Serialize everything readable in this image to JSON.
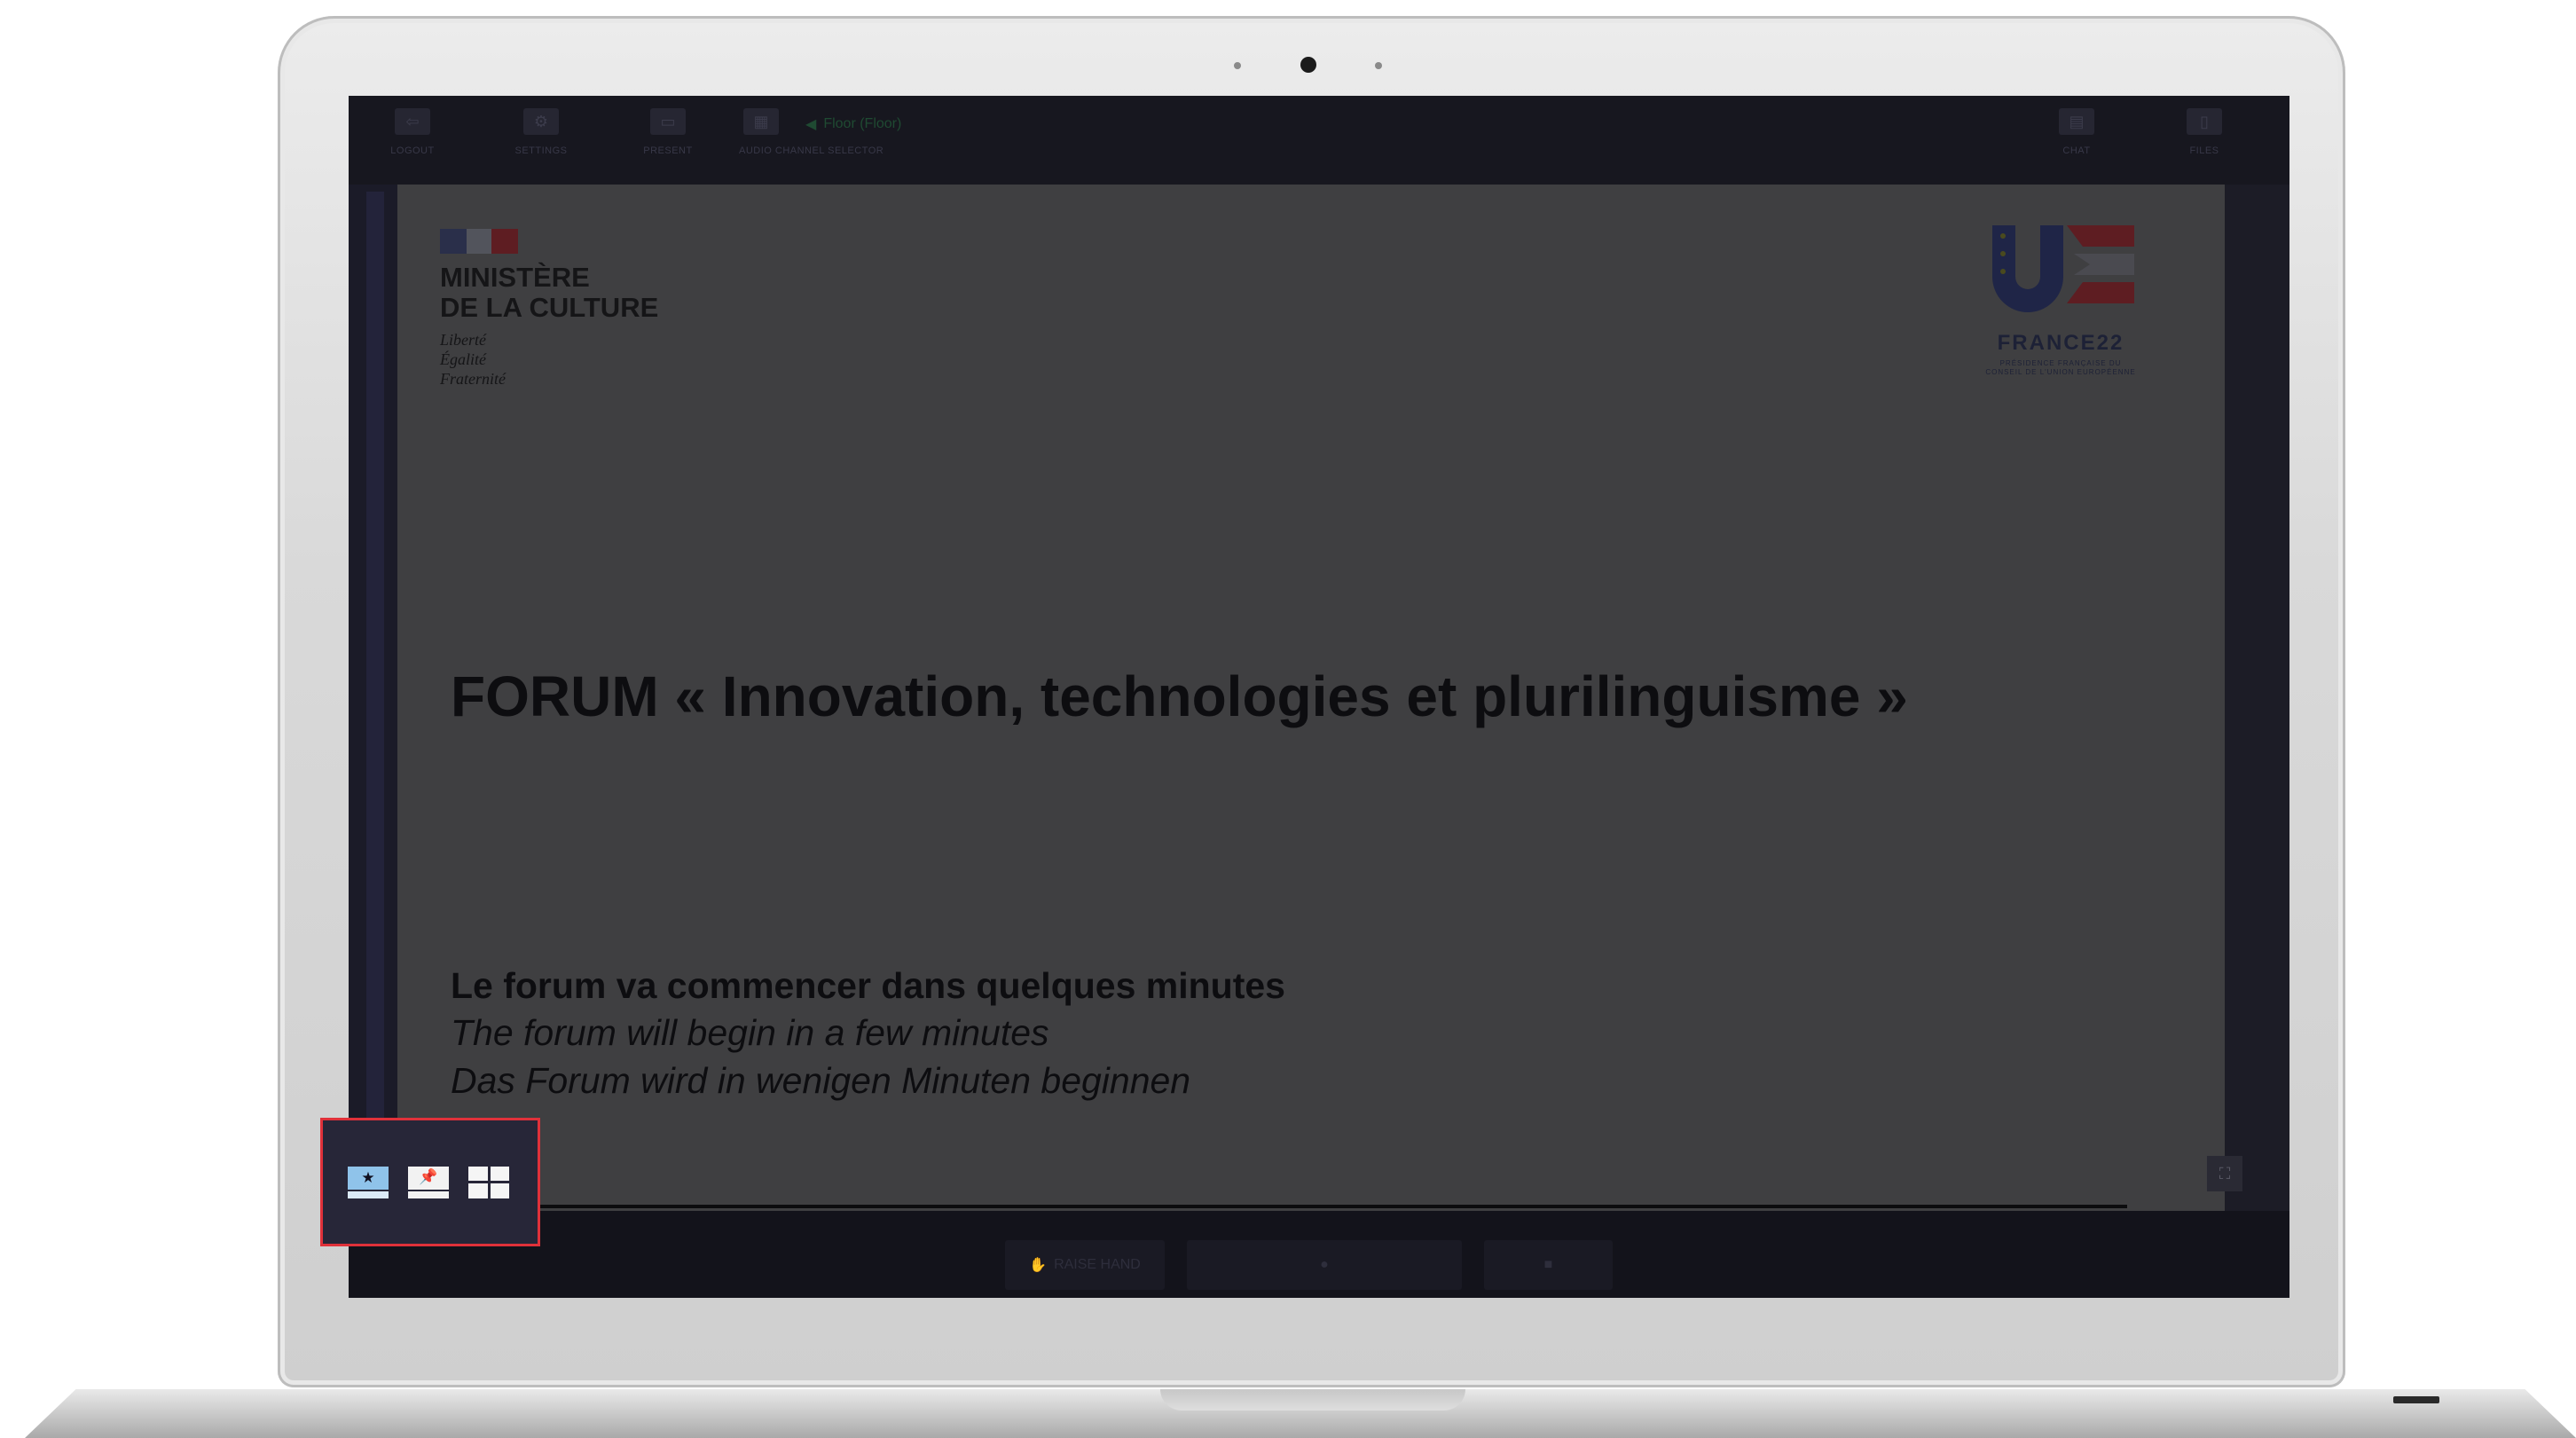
{
  "toolbar": {
    "buttons": [
      {
        "label": "LOGOUT",
        "icon": "logout-icon"
      },
      {
        "label": "SETTINGS",
        "icon": "gear-icon"
      },
      {
        "label": "PRESENT",
        "icon": "present-icon"
      },
      {
        "label": "AUDIO CHANNEL SELECTOR",
        "icon": "audio-channel-icon"
      }
    ],
    "audio_channel_value": "Floor (Floor)",
    "right_buttons": [
      {
        "label": "CHAT",
        "icon": "chat-icon"
      },
      {
        "label": "FILES",
        "icon": "files-icon"
      }
    ]
  },
  "slide": {
    "ministry_line1": "MINISTÈRE",
    "ministry_line2": "DE LA CULTURE",
    "motto": [
      "Liberté",
      "Égalité",
      "Fraternité"
    ],
    "eu_logo_text": "FRANCE22",
    "eu_logo_subtext": "PRÉSIDENCE FRANÇAISE DU CONSEIL DE L'UNION EUROPÉENNE",
    "title": "FORUM « Innovation, technologies et plurilinguisme »",
    "subtitle_fr": "Le forum va commencer dans quelques minutes",
    "subtitle_en": "The forum will begin in a few minutes",
    "subtitle_de": "Das Forum wird in wenigen Minuten beginnen"
  },
  "bottom_bar": {
    "raise_hand_label": "RAISE HAND"
  },
  "layout_switcher": {
    "options": [
      "speaker-view",
      "pinned-view",
      "grid-view"
    ],
    "selected": "speaker-view",
    "highlight_color": "#e0313a"
  },
  "colors": {
    "screen_bg": "#15151f",
    "slide_bg": "#3f3f41",
    "accent_blue": "#8fc3ea"
  }
}
